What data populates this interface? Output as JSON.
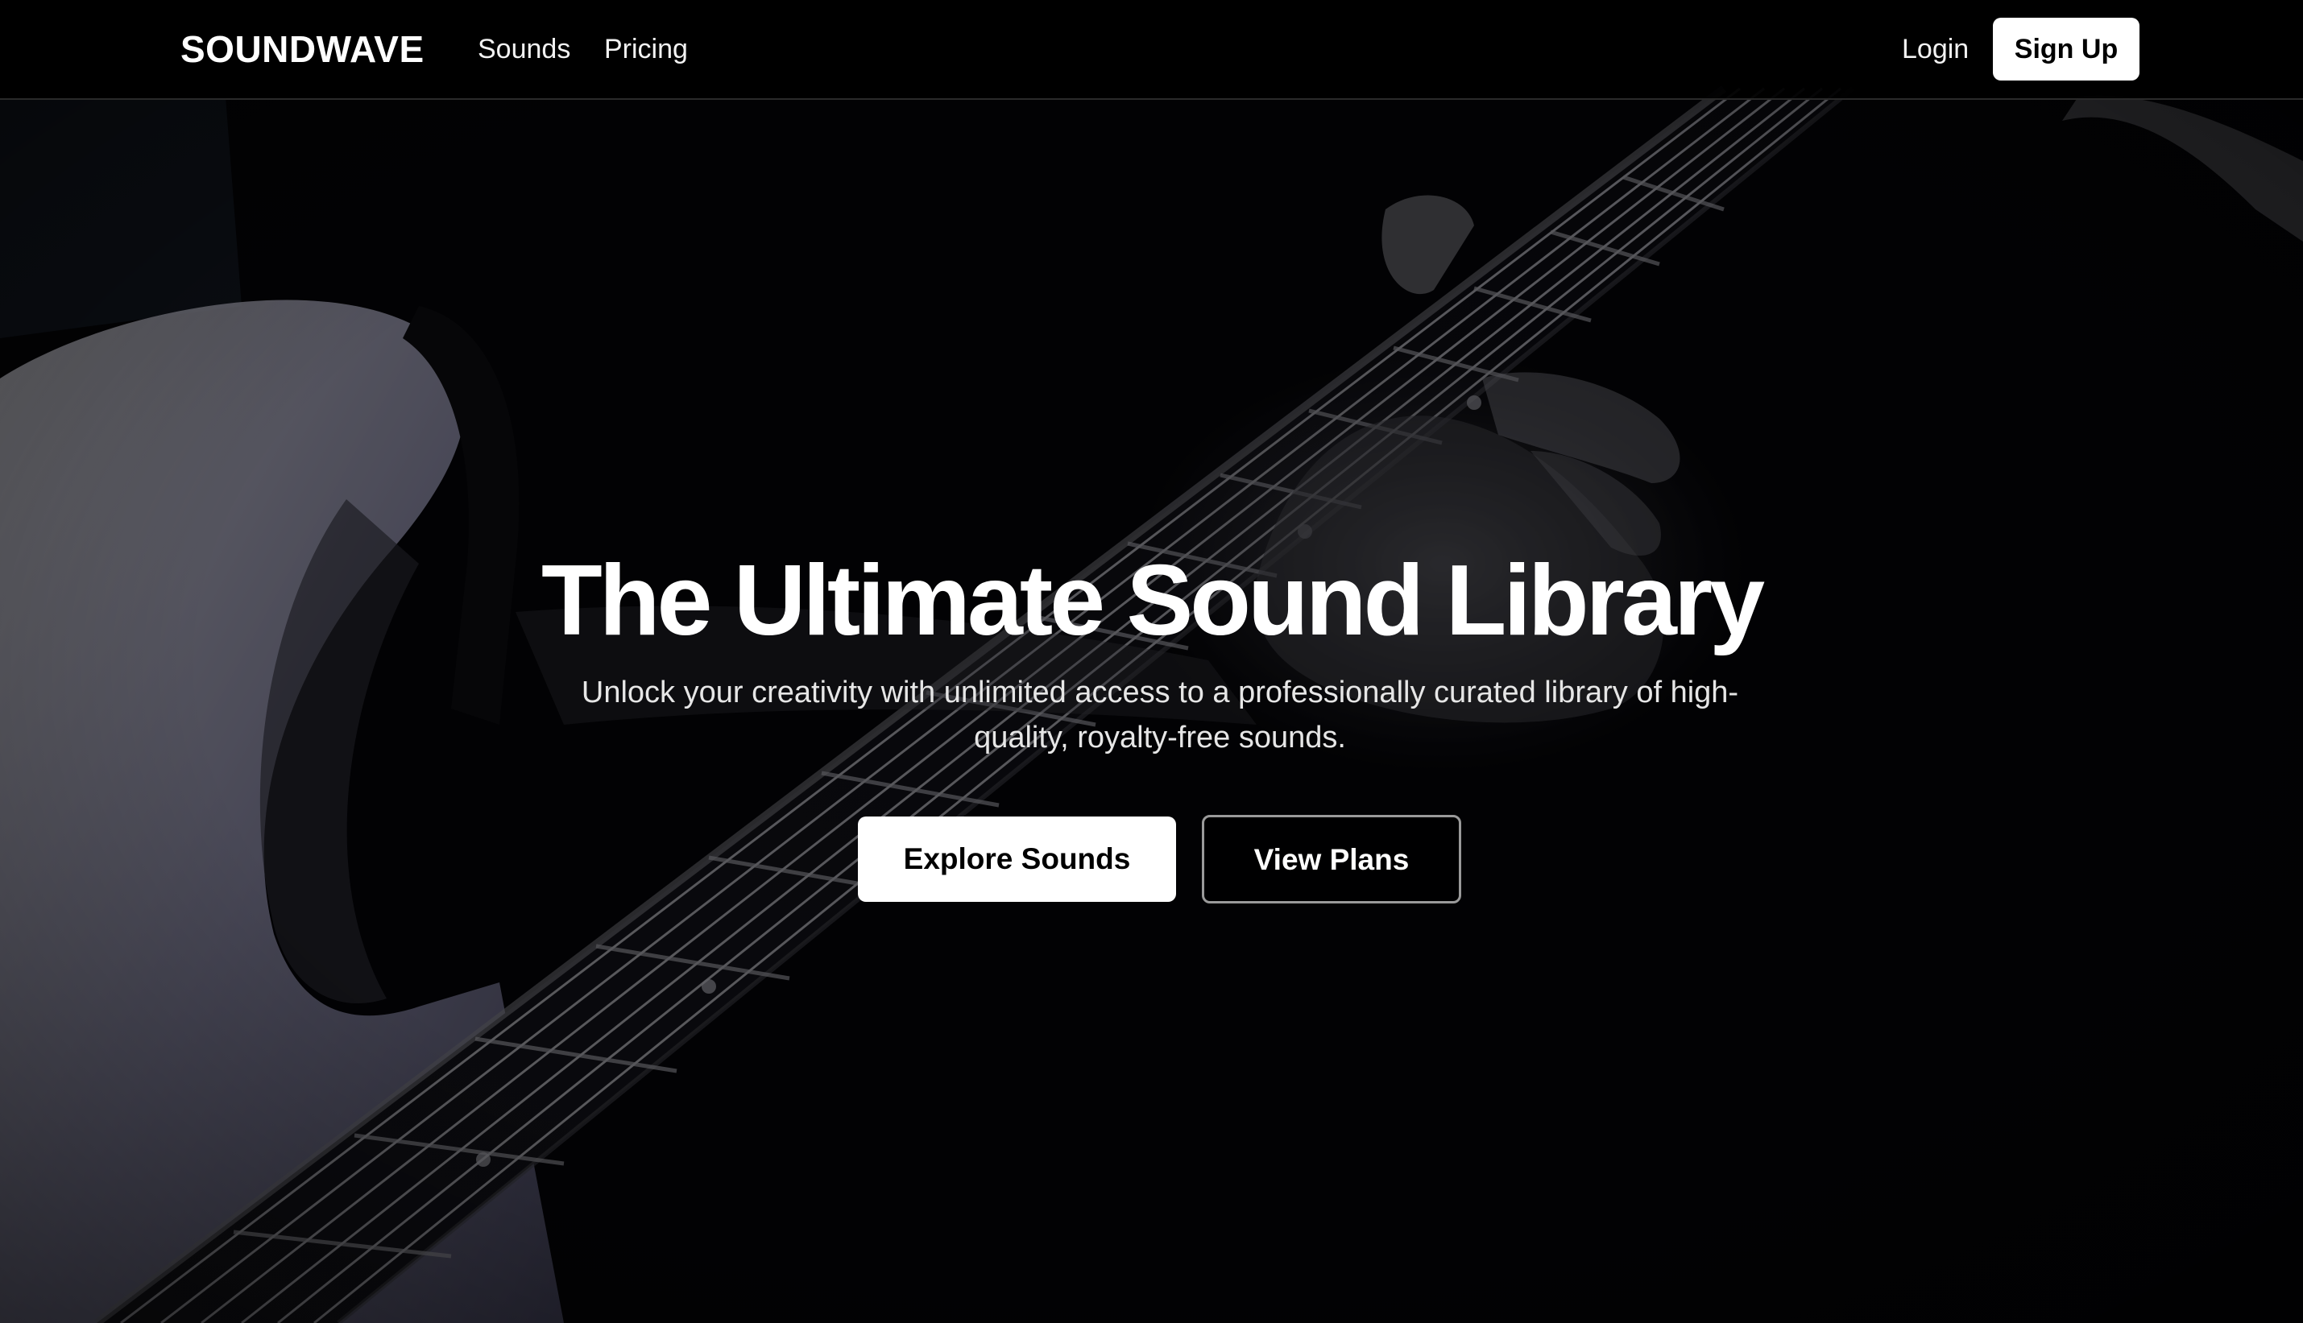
{
  "nav": {
    "brand": "SOUNDWAVE",
    "links": [
      "Sounds",
      "Pricing"
    ],
    "login": "Login",
    "signup": "Sign Up"
  },
  "hero": {
    "title": "The Ultimate Sound Library",
    "subtitle": "Unlock your creativity with unlimited access to a professionally curated library of high-quality, royalty-free sounds.",
    "primary_cta": "Explore Sounds",
    "secondary_cta": "View Plans",
    "background": "guitar-photo"
  },
  "colors": {
    "background": "#000000",
    "text": "#ffffff",
    "primary_button_bg": "#ffffff",
    "primary_button_text": "#000000"
  }
}
